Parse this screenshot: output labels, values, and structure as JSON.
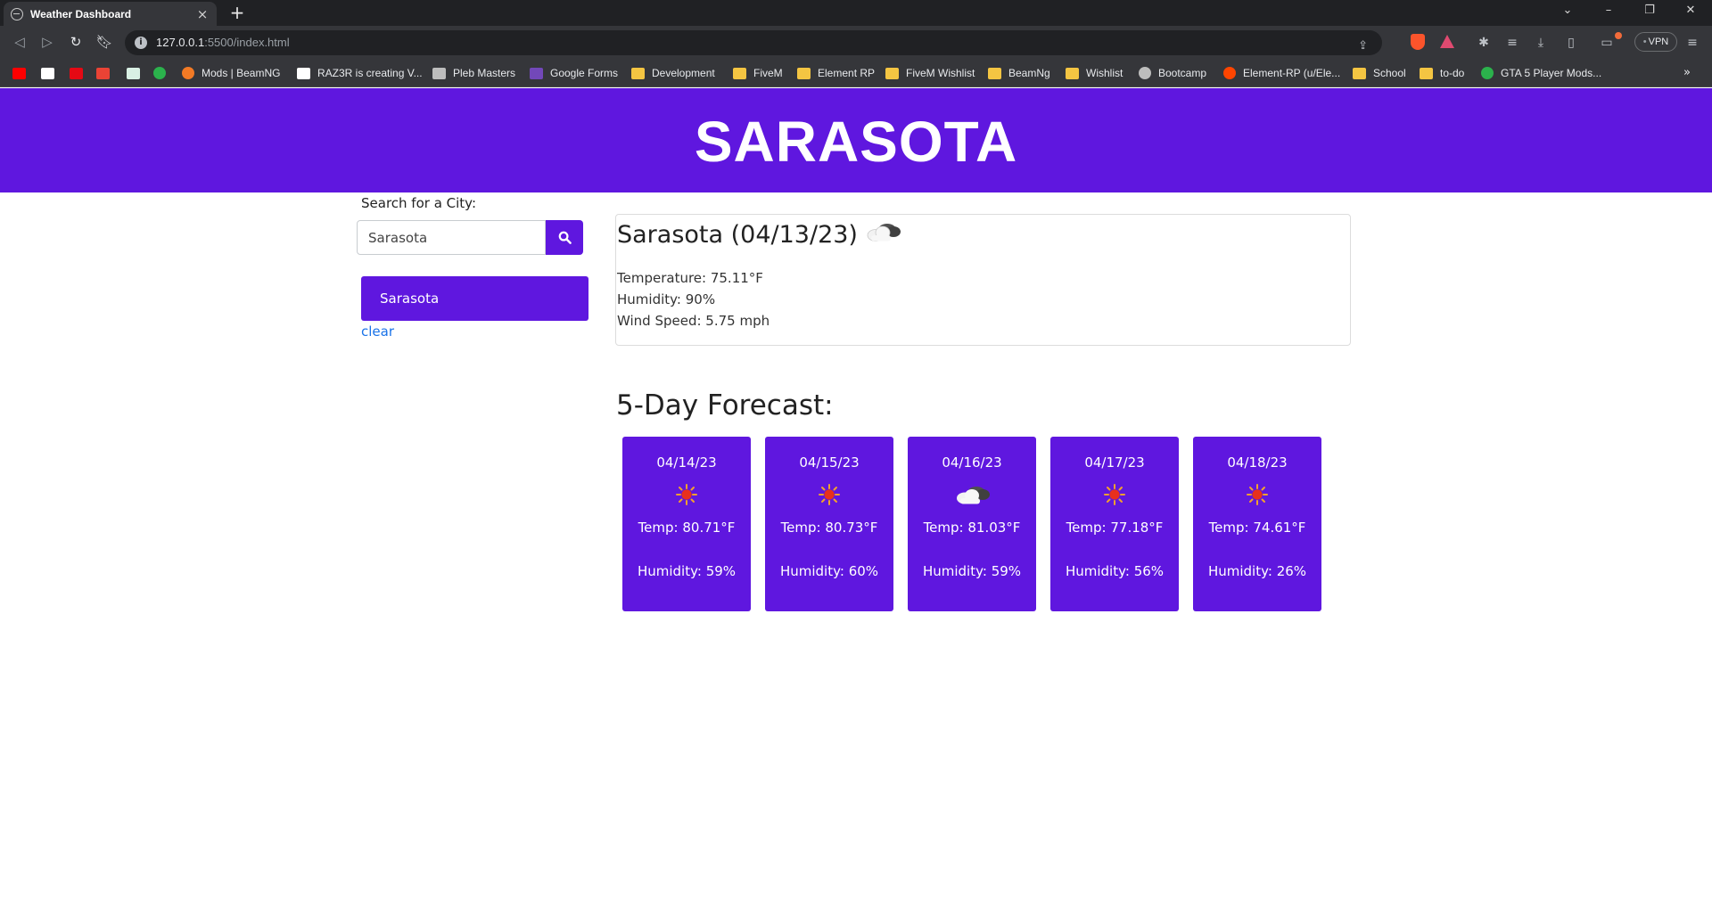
{
  "browser": {
    "tab_title": "Weather Dashboard",
    "url_host": "127.0.0.1",
    "url_rest": ":5500/index.html",
    "vpn_label": "VPN",
    "bookmarks": [
      {
        "label": "",
        "icon": "youtube-icon",
        "color": "#ff0000"
      },
      {
        "label": "",
        "icon": "amazon-icon",
        "color": "#ffffff"
      },
      {
        "label": "",
        "icon": "netflix-icon",
        "color": "#e50914"
      },
      {
        "label": "",
        "icon": "gmail-icon",
        "color": "#ea4335"
      },
      {
        "label": "",
        "icon": "chatgpt-icon",
        "color": "#d9f0e4"
      },
      {
        "label": "",
        "icon": "green-round-icon",
        "color": "#2bb24c"
      },
      {
        "label": "Mods | BeamNG",
        "icon": "beamng-icon",
        "color": "#f27a25"
      },
      {
        "label": "RAZ3R is creating V...",
        "icon": "patreon-icon",
        "color": "#ffffff"
      },
      {
        "label": "Pleb Masters",
        "icon": "pleb-icon",
        "color": "#bdbdbd"
      },
      {
        "label": "Google Forms",
        "icon": "forms-icon",
        "color": "#7248b9"
      },
      {
        "label": "Development",
        "icon": "folder-icon",
        "color": "#f4c542"
      },
      {
        "label": "FiveM",
        "icon": "folder-icon",
        "color": "#f4c542"
      },
      {
        "label": "Element RP",
        "icon": "folder-icon",
        "color": "#f4c542"
      },
      {
        "label": "FiveM Wishlist",
        "icon": "folder-icon",
        "color": "#f4c542"
      },
      {
        "label": "BeamNg",
        "icon": "folder-icon",
        "color": "#f4c542"
      },
      {
        "label": "Wishlist",
        "icon": "folder-icon",
        "color": "#f4c542"
      },
      {
        "label": "Bootcamp",
        "icon": "globe-icon",
        "color": "#bdbdbd"
      },
      {
        "label": "Element-RP (u/Ele...",
        "icon": "reddit-icon",
        "color": "#ff4500"
      },
      {
        "label": "School",
        "icon": "folder-icon",
        "color": "#f4c542"
      },
      {
        "label": "to-do",
        "icon": "folder-icon",
        "color": "#f4c542"
      },
      {
        "label": "GTA 5 Player Mods...",
        "icon": "green-round-icon",
        "color": "#2bb24c"
      }
    ]
  },
  "header": {
    "city_title": "SARASOTA"
  },
  "search": {
    "label": "Search for a City:",
    "value": "Sarasota"
  },
  "history": [
    {
      "label": "Sarasota"
    }
  ],
  "clear_label": "clear",
  "current": {
    "heading": "Sarasota (04/13/23)",
    "icon": "cloud-dark-icon",
    "temperature": "Temperature: 75.11°F",
    "humidity": "Humidity: 90%",
    "wind": "Wind Speed: 5.75 mph"
  },
  "forecast": {
    "title": "5-Day Forecast:",
    "days": [
      {
        "date": "04/14/23",
        "icon": "sun-icon",
        "temp": "Temp: 80.71°F",
        "humidity": "Humidity: 59%"
      },
      {
        "date": "04/15/23",
        "icon": "sun-icon",
        "temp": "Temp: 80.73°F",
        "humidity": "Humidity: 60%"
      },
      {
        "date": "04/16/23",
        "icon": "cloud-icon",
        "temp": "Temp: 81.03°F",
        "humidity": "Humidity: 59%"
      },
      {
        "date": "04/17/23",
        "icon": "sun-icon",
        "temp": "Temp: 77.18°F",
        "humidity": "Humidity: 56%"
      },
      {
        "date": "04/18/23",
        "icon": "sun-icon",
        "temp": "Temp: 74.61°F",
        "humidity": "Humidity: 26%"
      }
    ]
  },
  "colors": {
    "brand": "#5f17df",
    "link": "#1a73e8"
  }
}
